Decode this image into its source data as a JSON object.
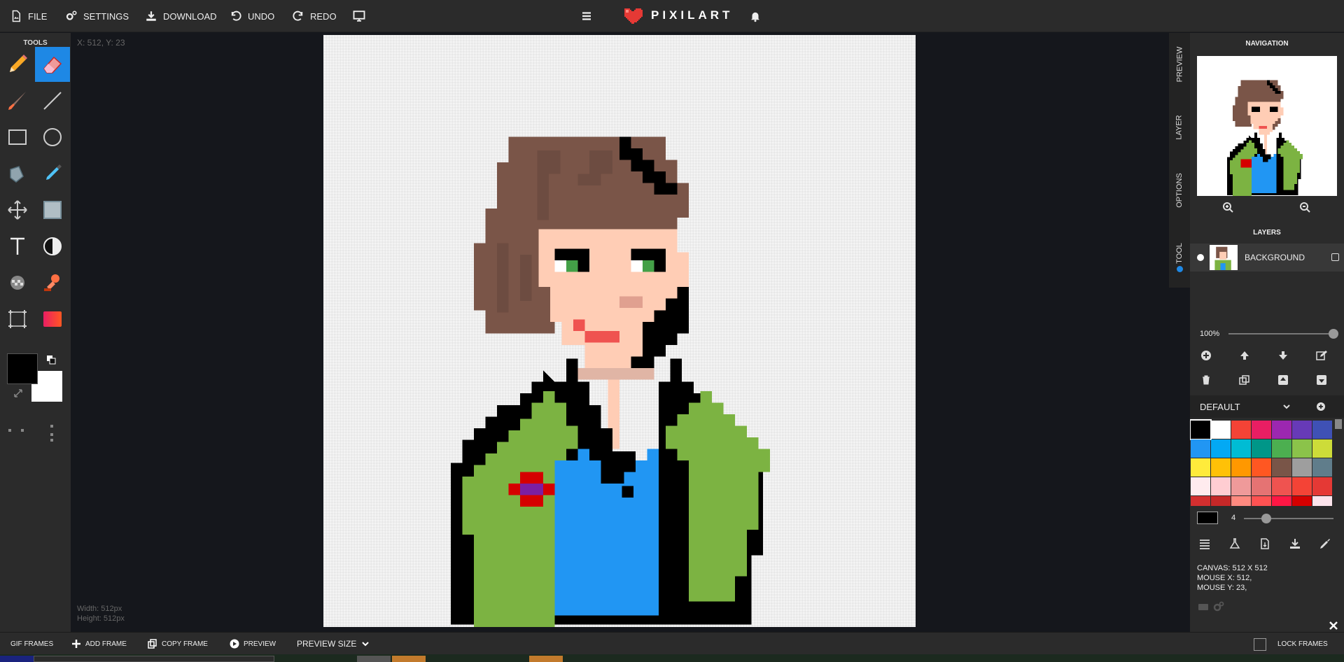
{
  "app": {
    "brand": "PIXILART"
  },
  "topbar": {
    "file": "FILE",
    "settings": "SETTINGS",
    "download": "DOWNLOAD",
    "undo": "UNDO",
    "redo": "REDO"
  },
  "tools": {
    "title": "TOOLS"
  },
  "canvas": {
    "coords": "X: 512, Y: 23",
    "width_label": "Width: 512px",
    "height_label": "Height: 512px"
  },
  "side_tabs": [
    "PREVIEW",
    "LAYER",
    "OPTIONS",
    "TOOL"
  ],
  "right_panel": {
    "navigation_title": "NAVIGATION",
    "layers_title": "LAYERS",
    "layer_name": "BACKGROUND",
    "opacity": "100%",
    "opacity_fraction": 1.0,
    "palette_name": "DEFAULT",
    "brush_size": "4",
    "brush_size_fraction": 0.25,
    "canvas_info": "CANVAS: 512 X 512",
    "mouse_x": "MOUSE X: 512,",
    "mouse_y": "MOUSE Y: 23,"
  },
  "palette": [
    "#000000",
    "#ffffff",
    "#f44336",
    "#e91e63",
    "#9c27b0",
    "#673ab7",
    "#3f51b5",
    "#2196f3",
    "#03a9f4",
    "#00bcd4",
    "#009688",
    "#4caf50",
    "#8bc34a",
    "#cddc39",
    "#ffeb3b",
    "#ffc107",
    "#ff9800",
    "#ff5722",
    "#795548",
    "#9e9e9e",
    "#607d8b",
    "#ffebee",
    "#ffcdd2",
    "#ef9a9a",
    "#e57373",
    "#ef5350",
    "#f44336",
    "#e53935",
    "#d32f2f",
    "#c62828",
    "#ff8a80",
    "#ff5252",
    "#ff1744",
    "#d50000",
    "#fce4ec"
  ],
  "bottombar": {
    "gif_frames": "GIF FRAMES",
    "add_frame": "ADD FRAME",
    "copy_frame": "COPY FRAME",
    "preview": "PREVIEW",
    "preview_size": "PREVIEW SIZE",
    "lock_frames": "LOCK FRAMES"
  },
  "colors": {
    "accent": "#1e88e5",
    "primary_color": "#000000",
    "secondary_color": "#ffffff"
  }
}
